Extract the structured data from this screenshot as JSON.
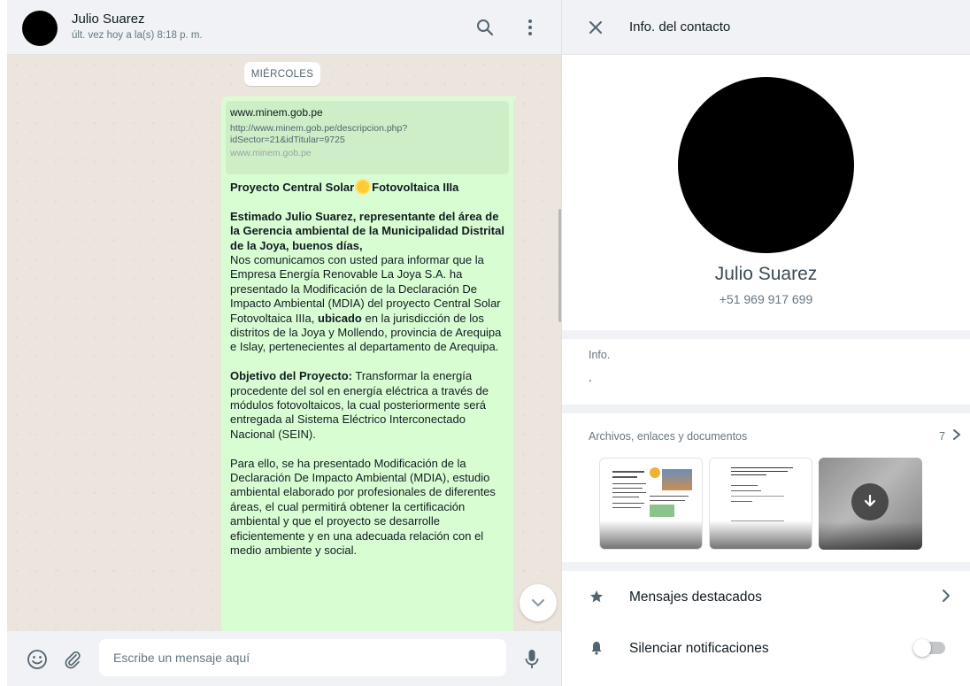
{
  "chat": {
    "header": {
      "name": "Julio Suarez",
      "status": "últ. vez hoy a la(s) 8:18 p. m."
    },
    "date_chip": "MIÉRCOLES",
    "message": {
      "link_preview": {
        "title": "www.minem.gob.pe",
        "description": "http://www.minem.gob.pe/descripcion.php?idSector=21&idTitular=9725",
        "domain": "www.minem.gob.pe"
      },
      "heading_pre": "Proyecto Central Solar",
      "heading_post": "Fotovoltaica IIIa",
      "greeting": "Estimado Julio Suarez, representante del área de la Gerencia ambiental de la Municipalidad Distrital de la Joya, buenos días,",
      "para1_a": "Nos comunicamos con usted para informar que la Empresa Energía Renovable La Joya S.A. ha presentado la Modificación de la Declaración De Impacto Ambiental (MDIA) del proyecto Central Solar Fotovoltaica IIIa,",
      "para1_bold": "ubicado",
      "para1_b": "en la jurisdicción de los distritos de la Joya y Mollendo, provincia de Arequipa e Islay, pertenecientes al departamento de Arequipa.",
      "objective_label": "Objetivo del Proyecto:",
      "objective_text": "Transformar la energía procedente del sol en energía eléctrica a través de módulos fotovoltaicos, la cual posteriormente será entregada al Sistema Eléctrico Interconectado Nacional (SEIN).",
      "para3": "Para ello, se ha presentado Modificación de la Declaración De Impacto Ambiental (MDIA), estudio ambiental elaborado por profesionales de diferentes áreas, el cual permitirá obtener la certificación ambiental y que el proyecto se desarrolle eficientemente y en una adecuada relación con el medio ambiente y social."
    },
    "composer": {
      "placeholder": "Escribe un mensaje aquí"
    }
  },
  "info_panel": {
    "title": "Info. del contacto",
    "profile": {
      "name": "Julio Suarez",
      "phone": "+51 969 917 699"
    },
    "about": {
      "label": "Info.",
      "text": "."
    },
    "media": {
      "label": "Archivos, enlaces y documentos",
      "count": "7"
    },
    "actions": {
      "starred": "Mensajes destacados",
      "mute": "Silenciar notificaciones",
      "mute_on": false
    }
  },
  "colors": {
    "bubble": "#d9fdd3",
    "link_preview": "#cdeec7",
    "panel_bg": "#f0f2f5",
    "chat_bg": "#ece5dd"
  },
  "icons": [
    "search-icon",
    "menu-icon",
    "emoji-icon",
    "attach-icon",
    "mic-icon",
    "chevron-down-icon",
    "close-icon",
    "chevron-right-icon",
    "star-icon",
    "bell-icon",
    "download-icon"
  ]
}
